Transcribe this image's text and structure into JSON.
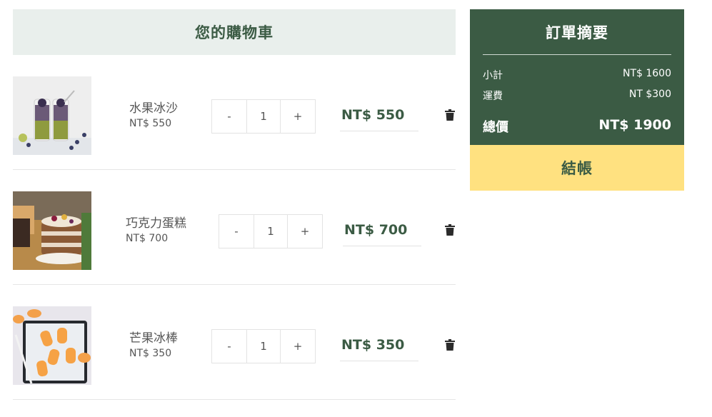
{
  "cart": {
    "title": "您的購物車",
    "items": [
      {
        "name": "水果冰沙",
        "unit_price": "NT$ 550",
        "qty": "1",
        "minus": "-",
        "plus": "+",
        "total": "NT$ 550"
      },
      {
        "name": "巧克力蛋糕",
        "unit_price": "NT$ 700",
        "qty": "1",
        "minus": "-",
        "plus": "+",
        "total": "NT$ 700"
      },
      {
        "name": "芒果冰棒",
        "unit_price": "NT$ 350",
        "qty": "1",
        "minus": "-",
        "plus": "+",
        "total": "NT$ 350"
      }
    ]
  },
  "summary": {
    "title": "訂單摘要",
    "subtotal_label": "小計",
    "subtotal_value": "NT$ 1600",
    "shipping_label": "運費",
    "shipping_value": "NT $300",
    "total_label": "總價",
    "total_value": "NT$ 1900",
    "checkout_label": "結帳"
  },
  "colors": {
    "primary_green": "#3b5b44",
    "header_bg": "#e9efec",
    "checkout_yellow": "#ffe180"
  }
}
